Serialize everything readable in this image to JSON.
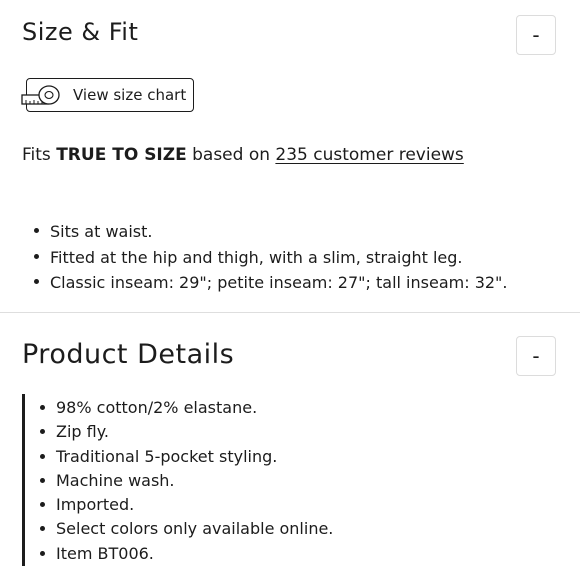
{
  "size_fit": {
    "title": "Size & Fit",
    "collapse_label": "-",
    "size_chart_label": "View size chart",
    "fit_prefix": "Fits ",
    "fit_value": "TRUE TO SIZE",
    "fit_middle": " based on ",
    "reviews_link": "235 customer reviews",
    "bullets": [
      "Sits at waist.",
      "Fitted at the hip and thigh, with a slim, straight leg.",
      "Classic inseam: 29\"; petite inseam: 27\"; tall inseam: 32\"."
    ]
  },
  "product_details": {
    "title": "Product Details",
    "collapse_label": "-",
    "bullets": [
      "98% cotton/2% elastane.",
      "Zip fly.",
      "Traditional 5-pocket styling.",
      "Machine wash.",
      "Imported.",
      "Select colors only available online.",
      "Item BT006."
    ]
  },
  "icons": {
    "size_chart": "measuring-tape-icon"
  }
}
